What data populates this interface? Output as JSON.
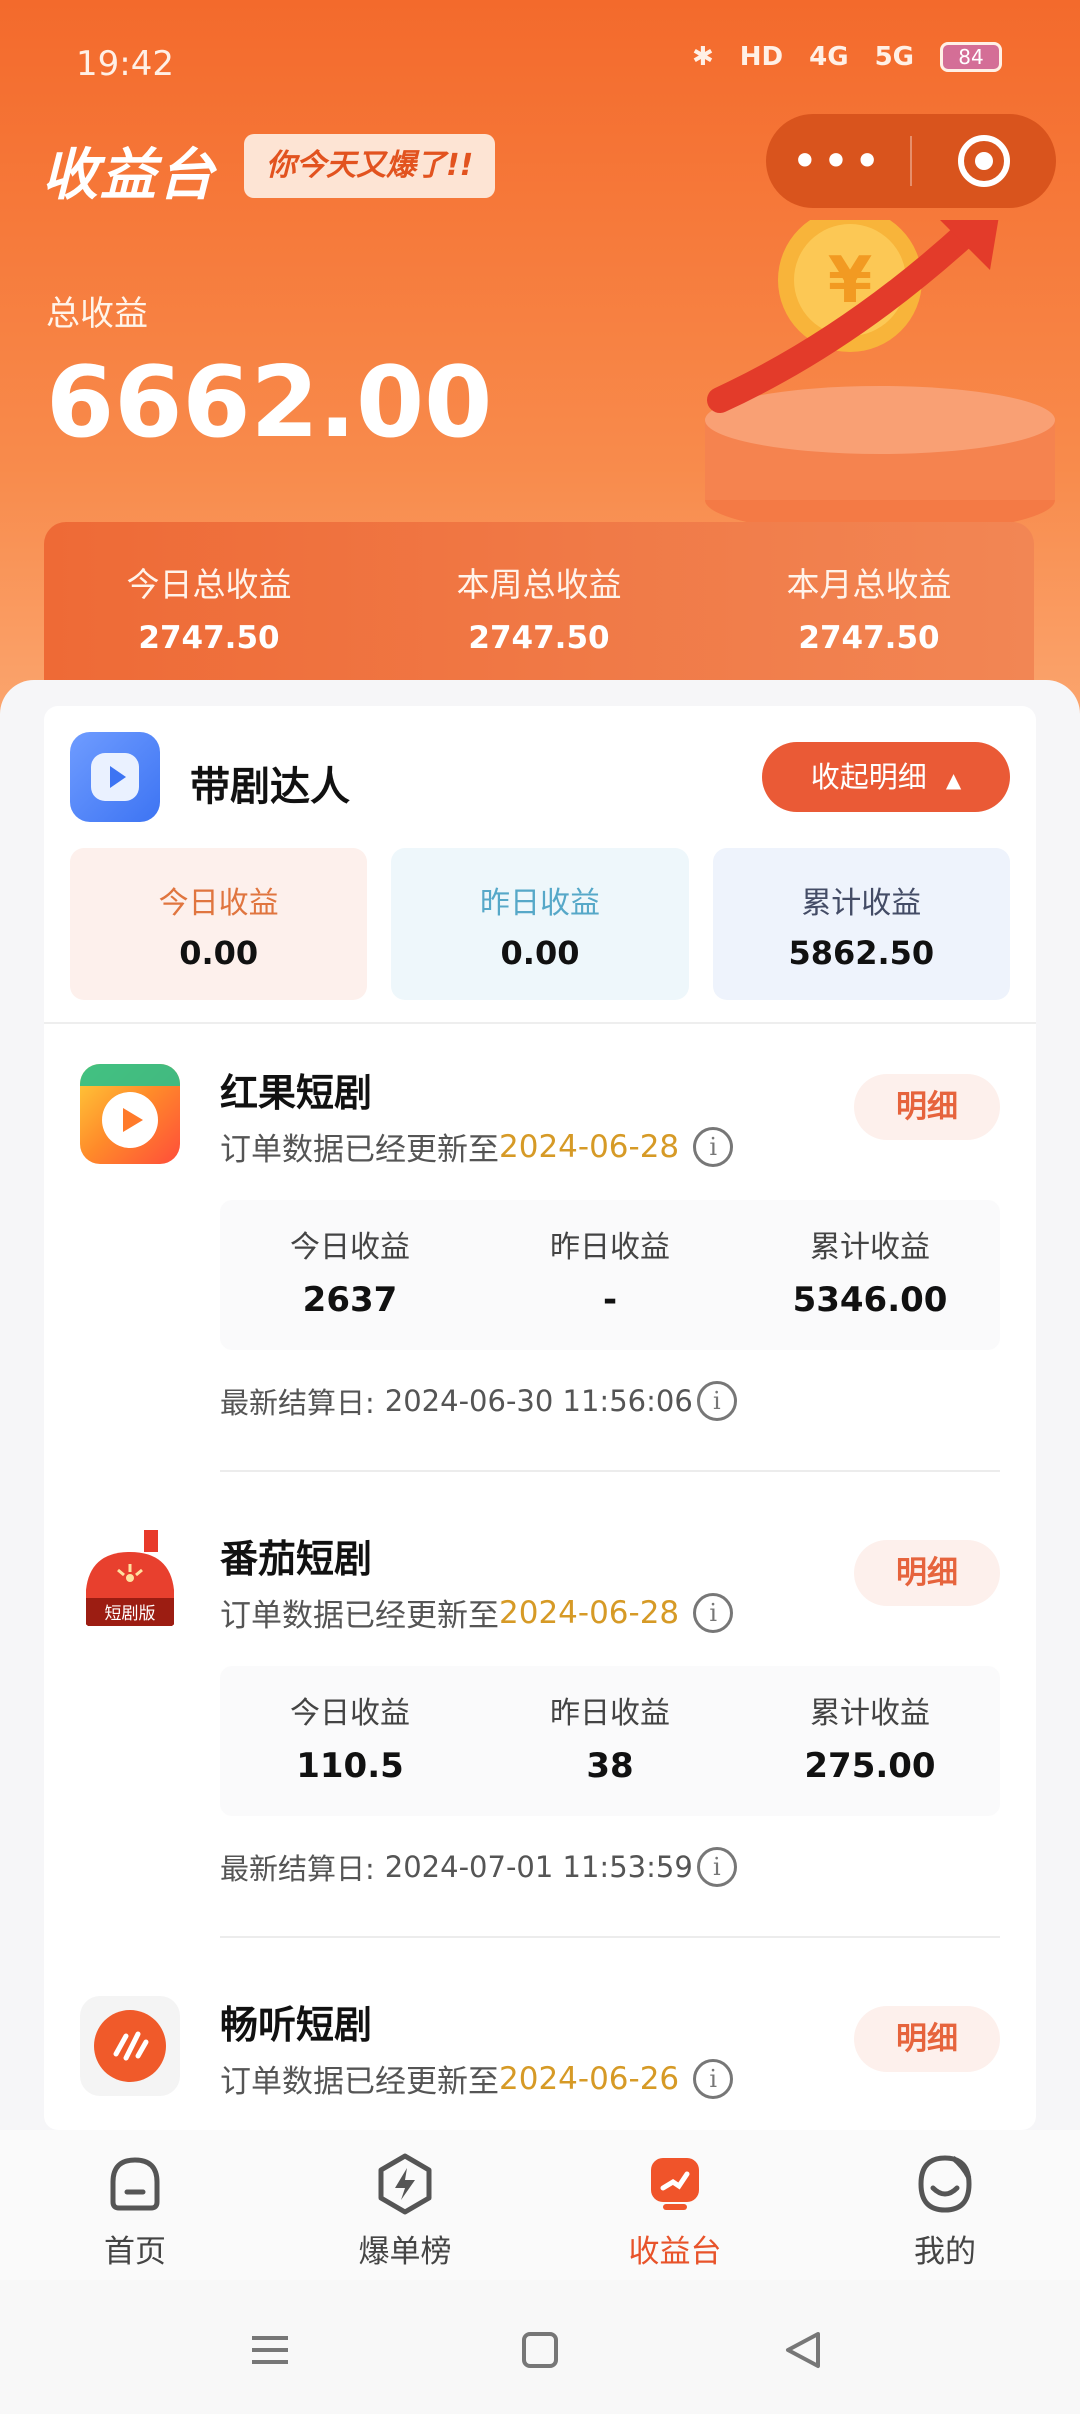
{
  "status_bar": {
    "time": "19:42",
    "hd": "HD",
    "net1": "4G",
    "net2": "5G",
    "battery": "84"
  },
  "header": {
    "title": "收益台",
    "slogan": "你今天又爆了!!",
    "more_icon": "more-dots-icon",
    "close_icon": "target-icon"
  },
  "totals": {
    "label": "总收益",
    "value": "6662.00",
    "periods": [
      {
        "label": "今日总收益",
        "value": "2747.50"
      },
      {
        "label": "本周总收益",
        "value": "2747.50"
      },
      {
        "label": "本月总收益",
        "value": "2747.50"
      }
    ]
  },
  "summary": {
    "title": "带剧达人",
    "collapse_label": "收起明细",
    "stats": [
      {
        "label": "今日收益",
        "value": "0.00"
      },
      {
        "label": "昨日收益",
        "value": "0.00"
      },
      {
        "label": "累计收益",
        "value": "5862.50"
      }
    ]
  },
  "platforms": [
    {
      "name": "红果短剧",
      "update_prefix": "订单数据已经更新至",
      "update_date": "2024-06-28",
      "detail_label": "明细",
      "stats": [
        {
          "label": "今日收益",
          "value": "2637"
        },
        {
          "label": "昨日收益",
          "value": "-"
        },
        {
          "label": "累计收益",
          "value": "5346.00"
        }
      ],
      "settle_label": "最新结算日:",
      "settle_time": "2024-06-30 11:56:06"
    },
    {
      "name": "番茄短剧",
      "logo_text": "短剧版",
      "update_prefix": "订单数据已经更新至",
      "update_date": "2024-06-28",
      "detail_label": "明细",
      "stats": [
        {
          "label": "今日收益",
          "value": "110.5"
        },
        {
          "label": "昨日收益",
          "value": "38"
        },
        {
          "label": "累计收益",
          "value": "275.00"
        }
      ],
      "settle_label": "最新结算日:",
      "settle_time": "2024-07-01 11:53:59"
    },
    {
      "name": "畅听短剧",
      "update_prefix": "订单数据已经更新至",
      "update_date": "2024-06-26",
      "detail_label": "明细"
    }
  ],
  "tabs": [
    {
      "label": "首页",
      "icon": "home-icon"
    },
    {
      "label": "爆单榜",
      "icon": "bolt-hexagon-icon"
    },
    {
      "label": "收益台",
      "icon": "earnings-icon",
      "active": true
    },
    {
      "label": "我的",
      "icon": "profile-face-icon"
    }
  ],
  "colors": {
    "brand": "#f36a2c",
    "accent": "#ea5a36",
    "date": "#d69a26"
  }
}
